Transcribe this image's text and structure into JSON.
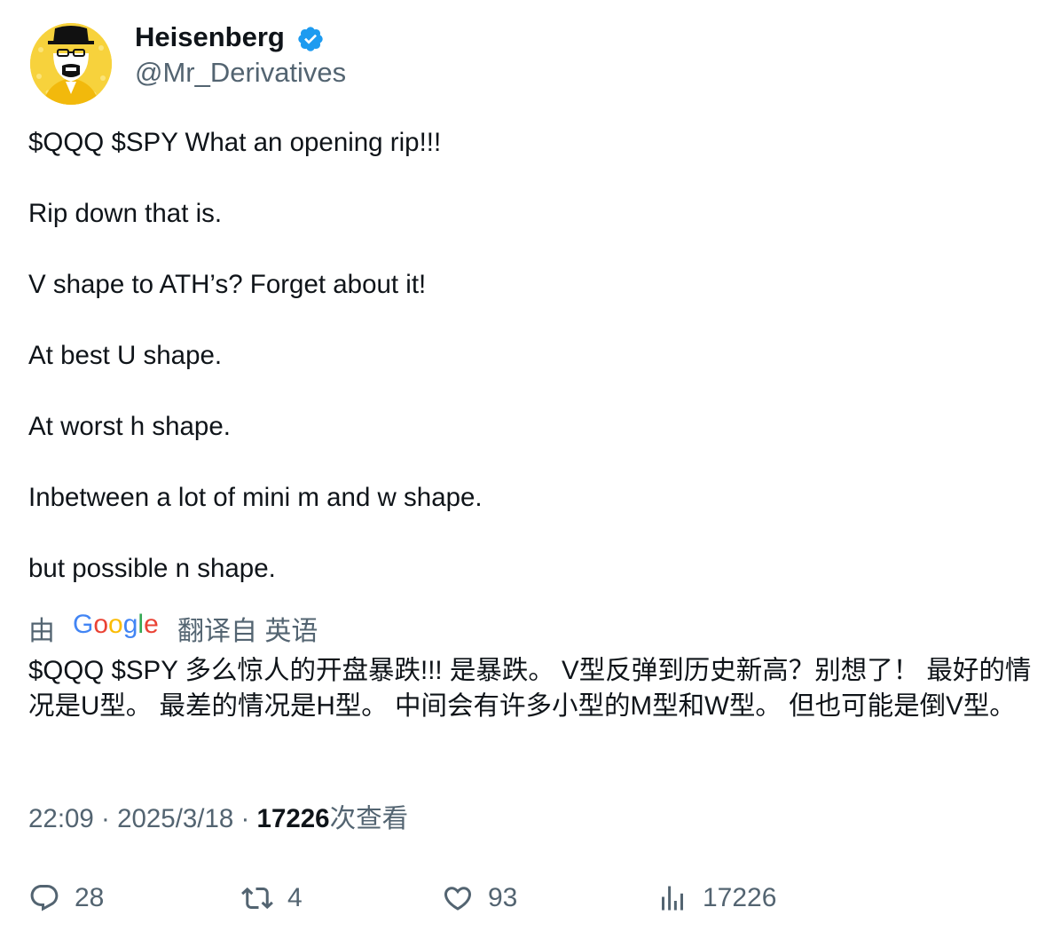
{
  "author": {
    "name": "Heisenberg",
    "handle": "@Mr_Derivatives",
    "verified": true,
    "verified_color": "#1d9bf0",
    "avatar_color": "#f7d23c"
  },
  "tweet": {
    "lines": [
      "$QQQ $SPY What an opening rip!!!",
      "Rip down that is.",
      "V shape to ATH’s? Forget about it!",
      "At best U shape.",
      "At worst h shape.",
      "Inbetween a lot of mini m and w shape.",
      "but possible n shape."
    ]
  },
  "translation": {
    "prefix": "由",
    "provider": "Google",
    "suffix": "翻译自 英语",
    "text": "$QQQ $SPY 多么惊人的开盘暴跌!!! 是暴跌。 V型反弹到历史新高？别想了！ 最好的情况是U型。 最差的情况是H型。 中间会有许多小型的M型和W型。 但也可能是倒V型。"
  },
  "meta": {
    "time": "22:09",
    "date": "2025/3/18",
    "views": "17226",
    "views_label": "次查看"
  },
  "actions": {
    "replies": "28",
    "retweets": "4",
    "likes": "93",
    "views": "17226"
  },
  "icons": {
    "reply": "speech-bubble-icon",
    "retweet": "retweet-arrows-icon",
    "like": "heart-icon",
    "views": "bar-chart-icon",
    "verified": "verified-badge-icon"
  }
}
